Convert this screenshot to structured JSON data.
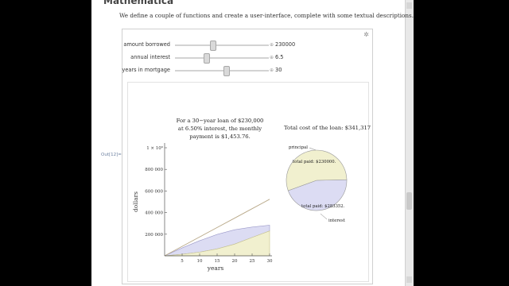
{
  "header": {
    "title": "Mathematica",
    "description": "We define a couple of functions and create a user-interface, complete with some textual descriptions."
  },
  "output_label": "Out[12]=",
  "manipulate": {
    "sliders": [
      {
        "label": "amount borrowed",
        "value": "230000",
        "fraction": 0.4
      },
      {
        "label": "annual interest",
        "value": "6.5",
        "fraction": 0.33
      },
      {
        "label": "years in mortgage",
        "value": "30",
        "fraction": 0.54
      }
    ],
    "plus_glyph": "⊕",
    "gear_glyph": "✲"
  },
  "summary": {
    "line1": "For a 30−year loan of $230,000",
    "line2": "at 6.50% interest, the monthly",
    "line3": "payment is $1,453.76.",
    "total_cost": "Total cost of the loan: $341,317"
  },
  "chart_data": [
    {
      "type": "area",
      "xlabel": "years",
      "ylabel": "dollars",
      "xlim": [
        0,
        30
      ],
      "ylim": [
        0,
        1000000
      ],
      "x_ticks": [
        "5",
        "10",
        "15",
        "20",
        "25",
        "30"
      ],
      "y_ticks": [
        "200 000",
        "400 000",
        "600 000",
        "800 000",
        "1 × 10⁶"
      ],
      "x": [
        0,
        5,
        10,
        15,
        20,
        25,
        30
      ],
      "series": [
        {
          "values": [
            0,
            87225,
            174451,
            261676,
            348902,
            436127,
            523353
          ]
        },
        {
          "values": [
            0,
            73000,
            140000,
            198000,
            241000,
            266000,
            283352
          ]
        },
        {
          "values": [
            0,
            14000,
            34000,
            64000,
            108000,
            170000,
            230000
          ]
        }
      ]
    },
    {
      "type": "pie",
      "labels": [
        "principal",
        "interest"
      ],
      "slice_labels": [
        "total paid: $230000.",
        "total paid: $283352."
      ],
      "values": [
        230000,
        283352
      ],
      "colors": [
        "#f1f0cf",
        "#dcdcf3"
      ]
    }
  ]
}
